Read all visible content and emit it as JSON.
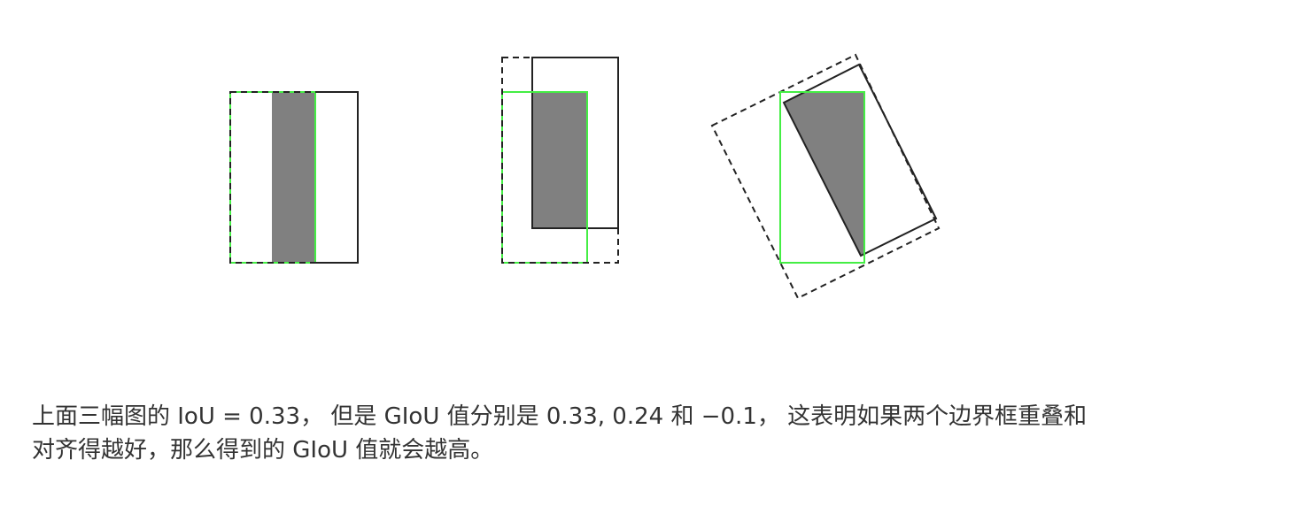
{
  "caption": {
    "line1": "上面三幅图的 IoU = 0.33， 但是 GIoU 值分别是 0.33, 0.24 和 −0.1， 这表明如果两个边界框重叠和",
    "line2": "对齐得越好，那么得到的 GIoU 值就会越高。"
  },
  "colors": {
    "ground_truth_box": "#44ee44",
    "predicted_box": "#222222",
    "enclosing_box": "#222222",
    "intersection_fill": "#808080",
    "caption_text": "#333333",
    "background": "#ffffff"
  },
  "diagrams": [
    {
      "iou": 0.33,
      "giou": 0.33
    },
    {
      "iou": 0.33,
      "giou": 0.24
    },
    {
      "iou": 0.33,
      "giou": -0.1
    }
  ]
}
